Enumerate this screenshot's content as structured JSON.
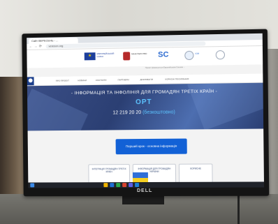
{
  "browser": {
    "tab_label": "Сайт ВЕРЕСЕНЬ - ...",
    "url": "vereson.org",
    "back": "←",
    "forward": "→",
    "reload": "⟳"
  },
  "logos": {
    "eu_caption": "ЄВРОПЕЙСЬКИЙ СОЮЗ",
    "logo2_caption": "МІНІСТЕРСТВО",
    "logo3_caption": "SC",
    "logo4_caption": "IOM"
  },
  "fineprint": "Проєкт фінансується Європейським Союзом ...",
  "menu": {
    "items": [
      "ПРО ПРОЄКТ",
      "НОВИНИ",
      "КОНТАКТИ",
      "ПАРТНЕРИ",
      "ДОКУМЕНТИ",
      "КОРИСНІ ПОСИЛАННЯ"
    ]
  },
  "hero": {
    "title": "- ІНФОРМАЦІЯ ТА ІНФОЛІНІЯ ДЛЯ ГРОМАДЯН ТРЕТІХ КРАЇН -",
    "logo_text": "ОРТ",
    "phone_main": "12 219 20 20",
    "phone_extra": "(безкоштовно)"
  },
  "main_button": "Перший крок - основна інформація",
  "cards": [
    {
      "label": "ІНТЕГРАЦІЯ ГРОМАДЯН ТРЕТІХ КРАЇН"
    },
    {
      "label": "ІНФОРМАЦІЯ ДЛЯ ГРОМАДЯН УКРАЇНИ"
    },
    {
      "label": "КОРИСНЕ"
    }
  ],
  "monitor_brand": "DELL",
  "colors": {
    "hero_bg": "#2b3f73",
    "accent_blue": "#1261d6",
    "logo_cyan": "#5cc4ff",
    "eu_blue": "#1d3f9c",
    "eu_gold": "#f4d000"
  }
}
